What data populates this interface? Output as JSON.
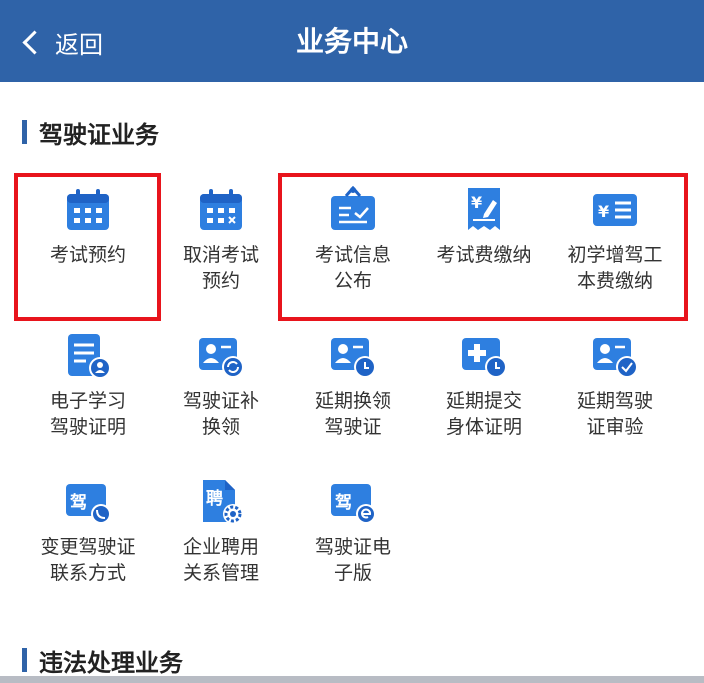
{
  "header": {
    "back_label": "返回",
    "title": "业务中心"
  },
  "sections": {
    "license": {
      "title": "驾驶证业务"
    },
    "violation": {
      "title": "违法处理业务"
    }
  },
  "tiles": {
    "t1": {
      "label": "考试预约",
      "icon": "calendar-icon"
    },
    "t2": {
      "label": "取消考试\n预约",
      "icon": "calendar-cancel-icon"
    },
    "t3": {
      "label": "考试信息\n公布",
      "icon": "clipboard-check-icon"
    },
    "t4": {
      "label": "考试费缴纳",
      "icon": "fee-receipt-icon"
    },
    "t5": {
      "label": "初学增驾工\n本费缴纳",
      "icon": "fee-card-icon"
    },
    "t6": {
      "label": "电子学习\n驾驶证明",
      "icon": "document-person-icon"
    },
    "t7": {
      "label": "驾驶证补\n换领",
      "icon": "id-card-refresh-icon"
    },
    "t8": {
      "label": "延期换领\n驾驶证",
      "icon": "id-card-clock-icon"
    },
    "t9": {
      "label": "延期提交\n身体证明",
      "icon": "medical-clock-icon"
    },
    "t10": {
      "label": "延期驾驶\n证审验",
      "icon": "id-card-check-icon"
    },
    "t11": {
      "label": "变更驾驶证\n联系方式",
      "icon": "card-phone-icon",
      "glyph": "驾"
    },
    "t12": {
      "label": "企业聘用\n关系管理",
      "icon": "document-gear-icon",
      "glyph": "聘"
    },
    "t13": {
      "label": "驾驶证电\n子版",
      "icon": "card-electronic-icon",
      "glyph": "驾"
    }
  },
  "colors": {
    "header_bg": "#2f63a8",
    "icon_blue": "#2e7fe0",
    "highlight_red": "#e8141c"
  }
}
